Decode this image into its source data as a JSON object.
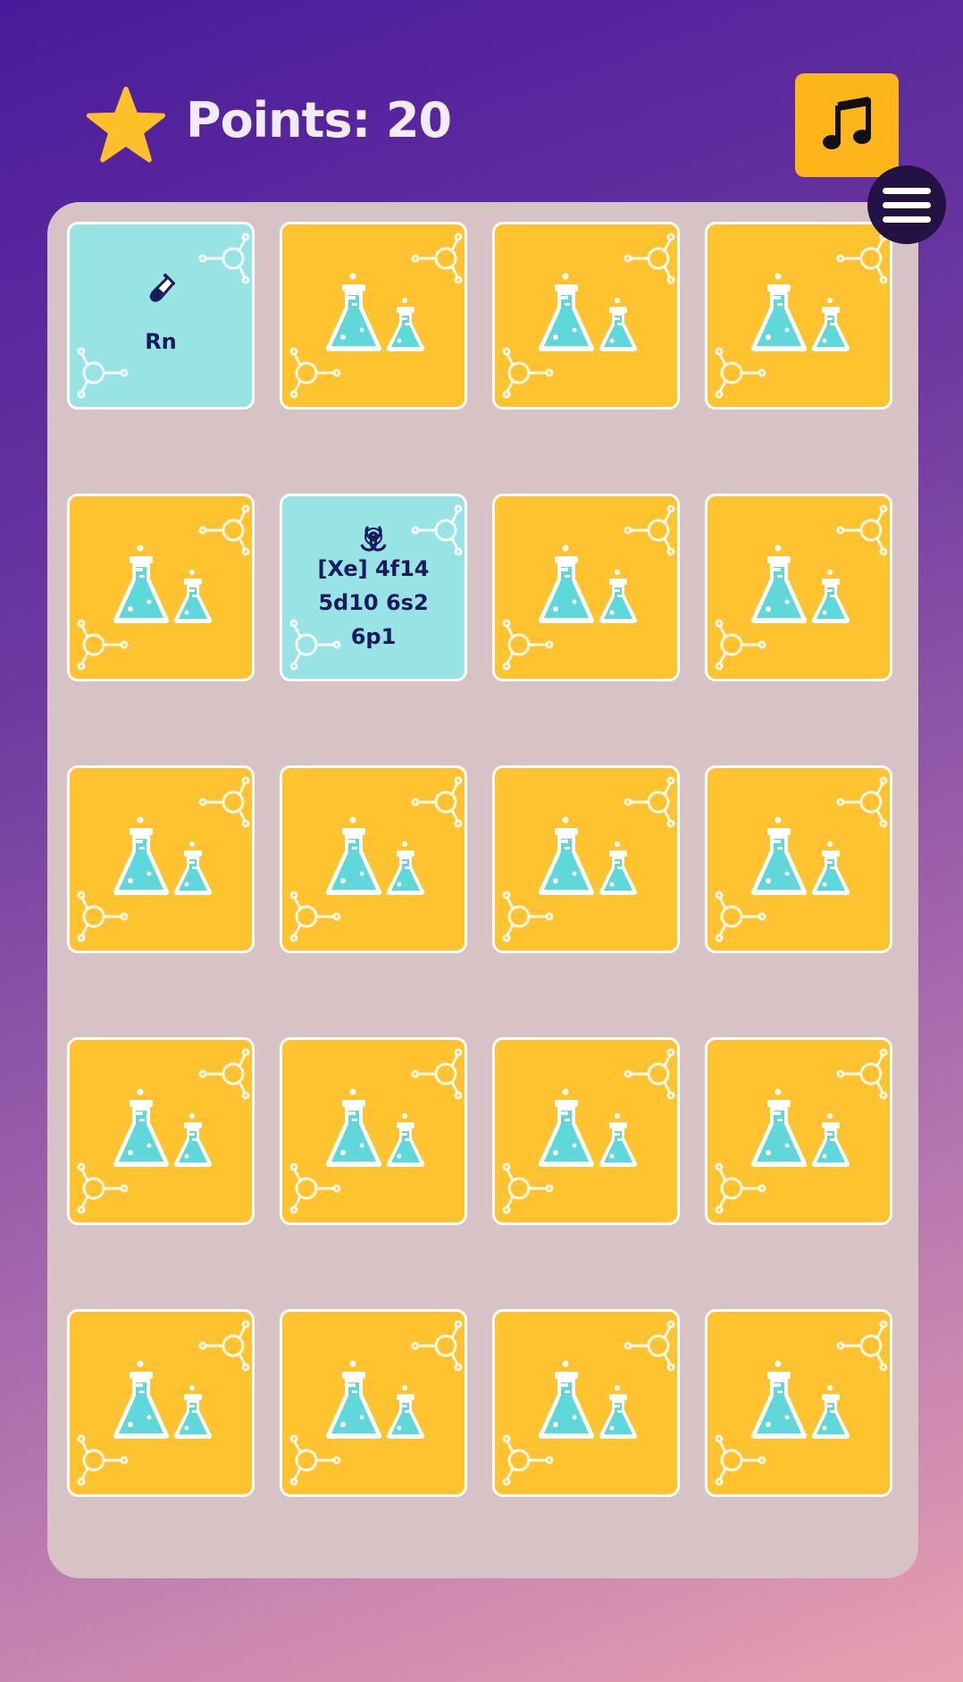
{
  "header": {
    "points_text": "Points: 20",
    "star_icon": "star-icon",
    "music_icon": "music-note-icon",
    "menu_icon": "hamburger-menu-icon"
  },
  "colors": {
    "card_back": "#fec32f",
    "card_front": "#98e4e4",
    "board": "#d7c3c5",
    "text": "#1a1a5e"
  },
  "board": {
    "rows": 5,
    "cols": 4,
    "cards": [
      {
        "state": "face-up",
        "icon": "test-tube-icon",
        "text": "Rn"
      },
      {
        "state": "face-down"
      },
      {
        "state": "face-down"
      },
      {
        "state": "face-down"
      },
      {
        "state": "face-down"
      },
      {
        "state": "face-up",
        "icon": "biohazard-icon",
        "text": "[Xe] 4f14 5d10 6s2 6p1"
      },
      {
        "state": "face-down"
      },
      {
        "state": "face-down"
      },
      {
        "state": "face-down"
      },
      {
        "state": "face-down"
      },
      {
        "state": "face-down"
      },
      {
        "state": "face-down"
      },
      {
        "state": "face-down"
      },
      {
        "state": "face-down"
      },
      {
        "state": "face-down"
      },
      {
        "state": "face-down"
      },
      {
        "state": "face-down"
      },
      {
        "state": "face-down"
      },
      {
        "state": "face-down"
      },
      {
        "state": "face-down"
      }
    ]
  }
}
